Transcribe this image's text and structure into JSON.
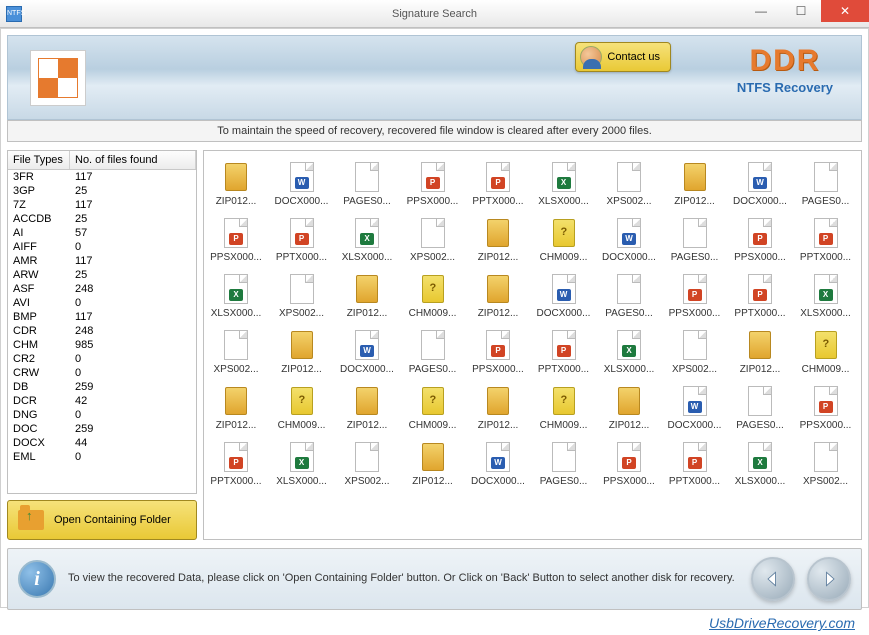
{
  "window": {
    "title": "Signature Search"
  },
  "banner": {
    "contact_label": "Contact us",
    "brand": "DDR",
    "subtitle": "NTFS Recovery"
  },
  "info_bar": "To maintain the speed of recovery, recovered file window is cleared after every 2000 files.",
  "table": {
    "col1": "File Types",
    "col2": "No. of files found",
    "rows": [
      {
        "t": "3FR",
        "n": "117"
      },
      {
        "t": "3GP",
        "n": "25"
      },
      {
        "t": "7Z",
        "n": "117"
      },
      {
        "t": "ACCDB",
        "n": "25"
      },
      {
        "t": "AI",
        "n": "57"
      },
      {
        "t": "AIFF",
        "n": "0"
      },
      {
        "t": "AMR",
        "n": "117"
      },
      {
        "t": "ARW",
        "n": "25"
      },
      {
        "t": "ASF",
        "n": "248"
      },
      {
        "t": "AVI",
        "n": "0"
      },
      {
        "t": "BMP",
        "n": "117"
      },
      {
        "t": "CDR",
        "n": "248"
      },
      {
        "t": "CHM",
        "n": "985"
      },
      {
        "t": "CR2",
        "n": "0"
      },
      {
        "t": "CRW",
        "n": "0"
      },
      {
        "t": "DB",
        "n": "259"
      },
      {
        "t": "DCR",
        "n": "42"
      },
      {
        "t": "DNG",
        "n": "0"
      },
      {
        "t": "DOC",
        "n": "259"
      },
      {
        "t": "DOCX",
        "n": "44"
      },
      {
        "t": "EML",
        "n": "0"
      }
    ]
  },
  "open_folder_label": "Open Containing Folder",
  "files": [
    {
      "n": "ZIP012...",
      "k": "zip"
    },
    {
      "n": "DOCX000...",
      "k": "doc"
    },
    {
      "n": "PAGES0...",
      "k": "page"
    },
    {
      "n": "PPSX000...",
      "k": "ppt"
    },
    {
      "n": "PPTX000...",
      "k": "ppt"
    },
    {
      "n": "XLSX000...",
      "k": "xls"
    },
    {
      "n": "XPS002...",
      "k": "page"
    },
    {
      "n": "ZIP012...",
      "k": "zip"
    },
    {
      "n": "DOCX000...",
      "k": "doc"
    },
    {
      "n": "PAGES0...",
      "k": "page"
    },
    {
      "n": "PPSX000...",
      "k": "ppsx"
    },
    {
      "n": "PPTX000...",
      "k": "ppt"
    },
    {
      "n": "XLSX000...",
      "k": "xls"
    },
    {
      "n": "XPS002...",
      "k": "page"
    },
    {
      "n": "ZIP012...",
      "k": "zip"
    },
    {
      "n": "CHM009...",
      "k": "chm"
    },
    {
      "n": "DOCX000...",
      "k": "doc"
    },
    {
      "n": "PAGES0...",
      "k": "page"
    },
    {
      "n": "PPSX000...",
      "k": "ppsx"
    },
    {
      "n": "PPTX000...",
      "k": "ppt"
    },
    {
      "n": "XLSX000...",
      "k": "xls"
    },
    {
      "n": "XPS002...",
      "k": "page"
    },
    {
      "n": "ZIP012...",
      "k": "zip"
    },
    {
      "n": "CHM009...",
      "k": "chm"
    },
    {
      "n": "ZIP012...",
      "k": "zip"
    },
    {
      "n": "DOCX000...",
      "k": "doc"
    },
    {
      "n": "PAGES0...",
      "k": "page"
    },
    {
      "n": "PPSX000...",
      "k": "ppsx"
    },
    {
      "n": "PPTX000...",
      "k": "ppt"
    },
    {
      "n": "XLSX000...",
      "k": "xls"
    },
    {
      "n": "XPS002...",
      "k": "page"
    },
    {
      "n": "ZIP012...",
      "k": "zip"
    },
    {
      "n": "DOCX000...",
      "k": "doc"
    },
    {
      "n": "PAGES0...",
      "k": "page"
    },
    {
      "n": "PPSX000...",
      "k": "ppsx"
    },
    {
      "n": "PPTX000...",
      "k": "ppt"
    },
    {
      "n": "XLSX000...",
      "k": "xls"
    },
    {
      "n": "XPS002...",
      "k": "page"
    },
    {
      "n": "ZIP012...",
      "k": "zip"
    },
    {
      "n": "CHM009...",
      "k": "chm"
    },
    {
      "n": "ZIP012...",
      "k": "zip"
    },
    {
      "n": "CHM009...",
      "k": "chm"
    },
    {
      "n": "ZIP012...",
      "k": "zip"
    },
    {
      "n": "CHM009...",
      "k": "chm"
    },
    {
      "n": "ZIP012...",
      "k": "zip"
    },
    {
      "n": "CHM009...",
      "k": "chm"
    },
    {
      "n": "ZIP012...",
      "k": "zip"
    },
    {
      "n": "DOCX000...",
      "k": "doc"
    },
    {
      "n": "PAGES0...",
      "k": "page"
    },
    {
      "n": "PPSX000...",
      "k": "ppsx"
    },
    {
      "n": "PPTX000...",
      "k": "ppt"
    },
    {
      "n": "XLSX000...",
      "k": "xls"
    },
    {
      "n": "XPS002...",
      "k": "page"
    },
    {
      "n": "ZIP012...",
      "k": "zip"
    },
    {
      "n": "DOCX000...",
      "k": "doc"
    },
    {
      "n": "PAGES0...",
      "k": "page"
    },
    {
      "n": "PPSX000...",
      "k": "ppsx"
    },
    {
      "n": "PPTX000...",
      "k": "ppt"
    },
    {
      "n": "XLSX000...",
      "k": "xls"
    },
    {
      "n": "XPS002...",
      "k": "page"
    }
  ],
  "footer_text": "To view the recovered Data, please click on 'Open Containing Folder' button. Or Click on 'Back' Button to select another disk for recovery.",
  "watermark": "UsbDriveRecovery.com"
}
